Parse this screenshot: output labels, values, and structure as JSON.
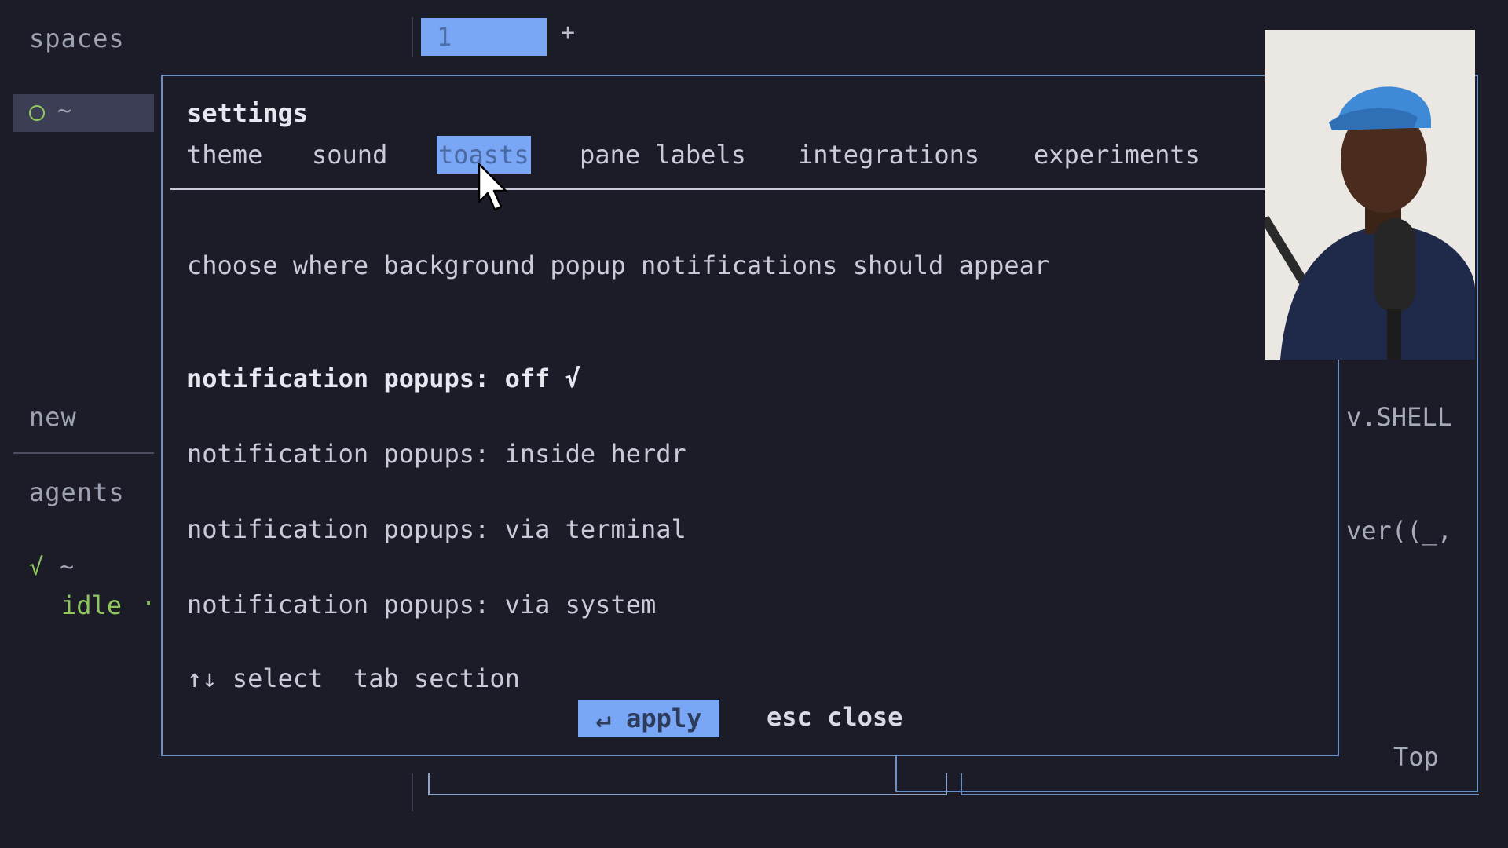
{
  "sidebar": {
    "spaces_label": "spaces",
    "space_item_label": "~",
    "new_label": "new",
    "agents_label": "agents",
    "agent_check": "√",
    "agent_name": "~",
    "agent_status": "idle",
    "agent_status_dot": "·"
  },
  "topbar": {
    "space_tab": "1",
    "add_tab": "+"
  },
  "background": {
    "shell_text": "v.SHELL",
    "code_text": "ver((_,",
    "top_label": "Top"
  },
  "settings": {
    "title": "settings",
    "tabs": [
      {
        "label": "theme"
      },
      {
        "label": "sound"
      },
      {
        "label": "toasts"
      },
      {
        "label": "pane labels"
      },
      {
        "label": "integrations"
      },
      {
        "label": "experiments"
      }
    ],
    "active_tab": "toasts",
    "description": "choose where background popup notifications should appear",
    "options": [
      {
        "label": "notification popups: off √"
      },
      {
        "label": "notification popups: inside herdr"
      },
      {
        "label": "notification popups: via terminal"
      },
      {
        "label": "notification popups: via system"
      }
    ],
    "hint": "↑↓ select  tab section",
    "apply_label": "↵ apply",
    "close_label": "esc close"
  },
  "colors": {
    "background": "#1b1c28",
    "accent": "#7aa7f5",
    "border": "#6b8fc2",
    "status_green": "#8fc75e"
  }
}
